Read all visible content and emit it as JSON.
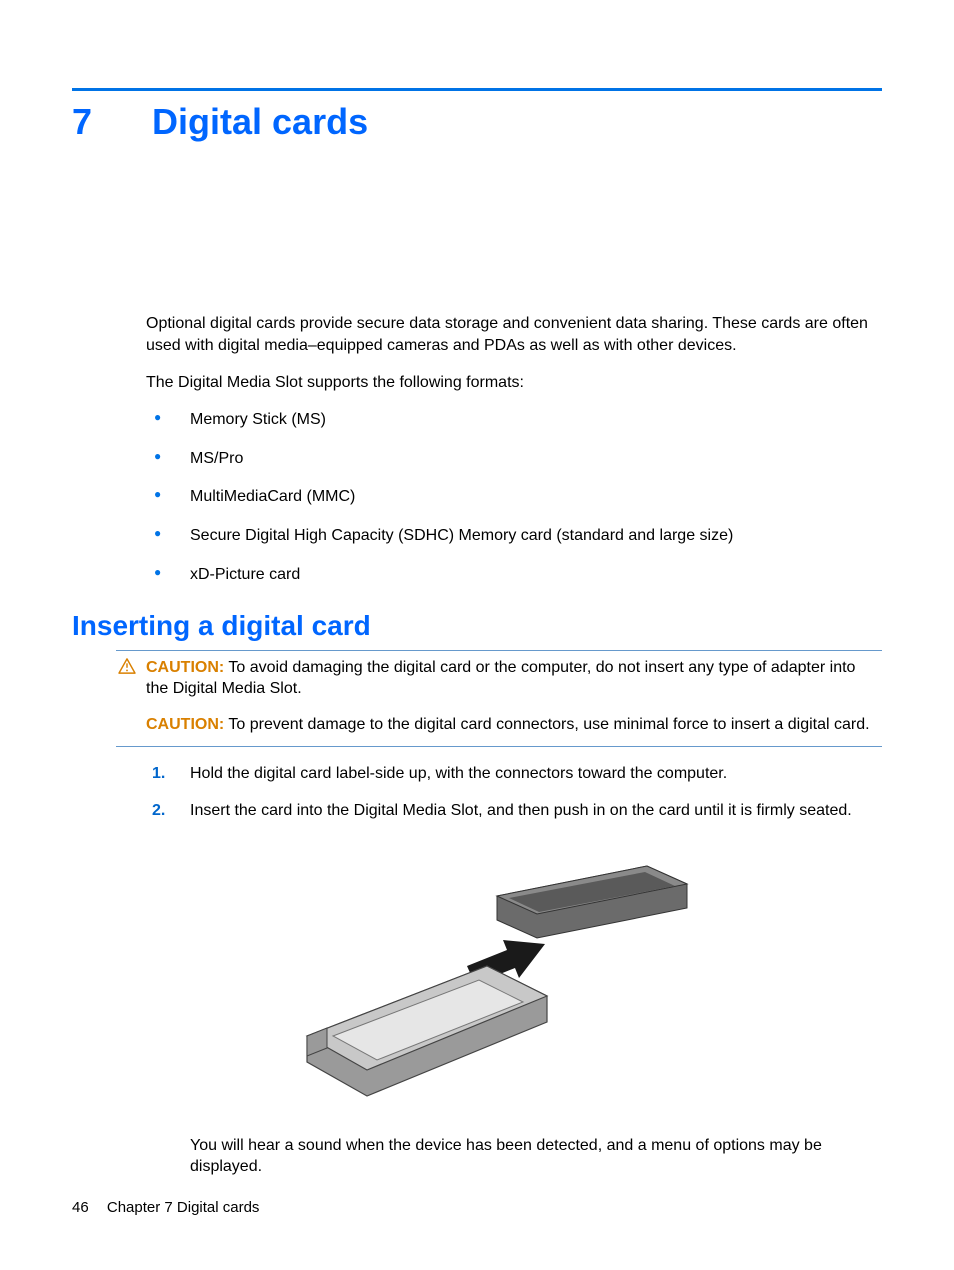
{
  "chapter": {
    "number": "7",
    "title": "Digital cards"
  },
  "intro": {
    "p1": "Optional digital cards provide secure data storage and convenient data sharing. These cards are often used with digital media–equipped cameras and PDAs as well as with other devices.",
    "p2": "The Digital Media Slot supports the following formats:"
  },
  "formats": [
    "Memory Stick (MS)",
    "MS/Pro",
    "MultiMediaCard (MMC)",
    "Secure Digital High Capacity (SDHC) Memory card (standard and large size)",
    "xD-Picture card"
  ],
  "section": {
    "title": "Inserting a digital card"
  },
  "caution": {
    "label": "CAUTION:",
    "c1": "To avoid damaging the digital card or the computer, do not insert any type of adapter into the Digital Media Slot.",
    "c2": "To prevent damage to the digital card connectors, use minimal force to insert a digital card."
  },
  "steps": {
    "s1": {
      "n": "1.",
      "t": "Hold the digital card label-side up, with the connectors toward the computer."
    },
    "s2": {
      "n": "2.",
      "t": "Insert the card into the Digital Media Slot, and then push in on the card until it is firmly seated."
    }
  },
  "after": "You will hear a sound when the device has been detected, and a menu of options may be displayed.",
  "footer": {
    "page": "46",
    "text": "Chapter 7   Digital cards"
  }
}
